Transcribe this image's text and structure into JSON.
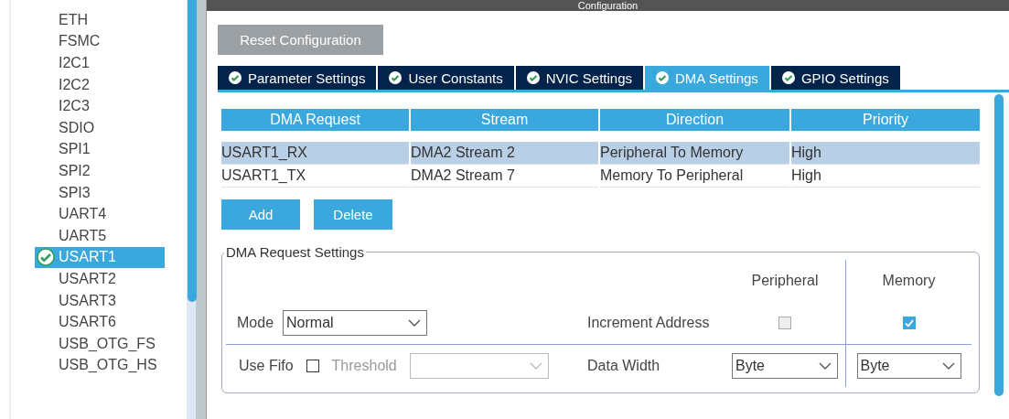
{
  "sidebar": {
    "items": [
      {
        "label": "ETH",
        "selected": false
      },
      {
        "label": "FSMC",
        "selected": false
      },
      {
        "label": "I2C1",
        "selected": false
      },
      {
        "label": "I2C2",
        "selected": false
      },
      {
        "label": "I2C3",
        "selected": false
      },
      {
        "label": "SDIO",
        "selected": false
      },
      {
        "label": "SPI1",
        "selected": false
      },
      {
        "label": "SPI2",
        "selected": false
      },
      {
        "label": "SPI3",
        "selected": false
      },
      {
        "label": "UART4",
        "selected": false
      },
      {
        "label": "UART5",
        "selected": false
      },
      {
        "label": "USART1",
        "selected": true
      },
      {
        "label": "USART2",
        "selected": false
      },
      {
        "label": "USART3",
        "selected": false
      },
      {
        "label": "USART6",
        "selected": false
      },
      {
        "label": "USB_OTG_FS",
        "selected": false
      },
      {
        "label": "USB_OTG_HS",
        "selected": false
      }
    ]
  },
  "configuration": {
    "title": "Configuration",
    "reset_button": "Reset Configuration",
    "tabs": [
      {
        "label": "Parameter Settings",
        "selected": false
      },
      {
        "label": "User Constants",
        "selected": false
      },
      {
        "label": "NVIC Settings",
        "selected": false
      },
      {
        "label": "DMA Settings",
        "selected": true
      },
      {
        "label": "GPIO Settings",
        "selected": false
      }
    ],
    "dma_table": {
      "columns": [
        "DMA Request",
        "Stream",
        "Direction",
        "Priority"
      ],
      "rows": [
        {
          "cells": [
            "USART1_RX",
            "DMA2 Stream 2",
            "Peripheral To Memory",
            "High"
          ],
          "selected": true
        },
        {
          "cells": [
            "USART1_TX",
            "DMA2 Stream 7",
            "Memory To Peripheral",
            "High"
          ],
          "selected": false
        }
      ]
    },
    "buttons": [
      "Add",
      "Delete"
    ],
    "request_settings": {
      "title": "DMA Request Settings",
      "column_headers": [
        "Peripheral",
        "Memory"
      ],
      "mode_label": "Mode",
      "mode_value": "Normal",
      "increment_label": "Increment Address",
      "increment_peripheral_checked": false,
      "increment_memory_checked": true,
      "use_fifo_label": "Use Fifo",
      "use_fifo_checked": false,
      "threshold_label": "Threshold",
      "threshold_disabled": true,
      "data_width_label": "Data Width",
      "data_width_peripheral": "Byte",
      "data_width_memory": "Byte"
    }
  }
}
